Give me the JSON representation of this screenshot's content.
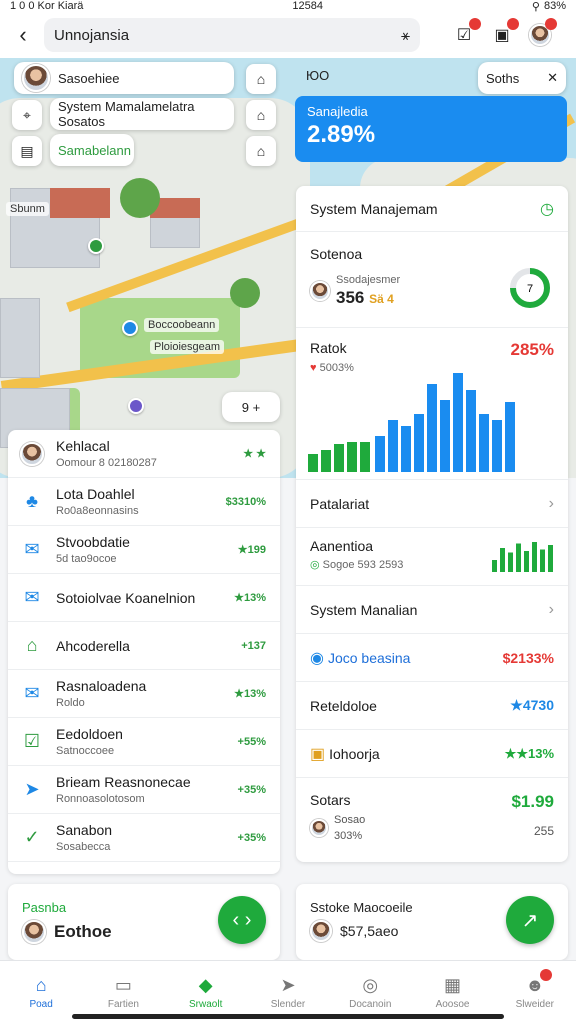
{
  "status": {
    "carrier": "1 0 0 Kor Kiarä",
    "time": "12584",
    "battery": "83%"
  },
  "topbar": {
    "title": "Unnojansia",
    "search_icon_glyph": "⚹"
  },
  "map": {
    "chips": [
      "Sasoehiee",
      "System Mamalamelatra Sosatos",
      "Samabelann"
    ],
    "labels": [
      "Sbunm",
      "Boccoobeann",
      "Ploioiesgeam"
    ],
    "zoom_label": "9  +",
    "top_text": "ЮO",
    "filter_label": "Soths"
  },
  "blue_card": {
    "title": "Sanajledia",
    "value": "2.89%"
  },
  "left_list": [
    {
      "name": "Kehlacal",
      "sub": "Oomour 8 02180287",
      "value": "★ ★",
      "icon": "avatar"
    },
    {
      "name": "Lota Doahlel",
      "sub": "Ro0a8eonnasins",
      "value": "$3310%",
      "icon": "tree-icon"
    },
    {
      "name": "Stvoobdatie",
      "sub": "5d tao9ocoe",
      "value": "★199",
      "icon": "mail-icon"
    },
    {
      "name": "Sotoiolvae Koanelnion",
      "sub": "",
      "value": "★13%",
      "icon": "send-mail-icon"
    },
    {
      "name": "Ahcoderella",
      "sub": "",
      "value": "+137",
      "icon": "home-icon"
    },
    {
      "name": "Rasnaloadena",
      "sub": "Roldo",
      "value": "★13%",
      "icon": "mail-icon"
    },
    {
      "name": "Eedoldoen",
      "sub": "Satnoccoee",
      "value": "+55%",
      "icon": "check-box-icon"
    },
    {
      "name": "Brieam Reasnonecae",
      "sub": "Ronnoasolotosom",
      "value": "+35%",
      "icon": "send-icon"
    },
    {
      "name": "Sanabon",
      "sub": "Sosabecca",
      "value": "+35%",
      "icon": "check-icon"
    }
  ],
  "left_card": {
    "title": "Pasnba",
    "name": "Eothoe",
    "action_glyph": "‹ ›"
  },
  "right_panel": {
    "header": "System Manajemam",
    "sotona": {
      "title": "Sotenoa",
      "sub": "Ssodajesmer",
      "value": "356",
      "value_suffix": "Sä 4",
      "ring_label": "7"
    },
    "chart": {
      "title": "Ratok",
      "sub": "5003%",
      "value": "285%"
    },
    "rows": [
      {
        "label": "Patalariat"
      },
      {
        "label": "Aanentioa",
        "sub": "Sogoe 593 2593"
      },
      {
        "label": "System Manalian"
      },
      {
        "label": "Joco beasina",
        "value": "$2133%"
      },
      {
        "label": "Reteldoloe",
        "value": "★4730"
      },
      {
        "label": "Iohoorja",
        "value": "★★13%"
      },
      {
        "label": "Sotars",
        "sub": "Sosao",
        "sub2": "303%",
        "value": "$1.99",
        "value2": "255"
      }
    ]
  },
  "right_card": {
    "title": "Sstoke Maocoeile",
    "value": "$57,5aeo",
    "action_glyph": "↗"
  },
  "nav": [
    {
      "label": "Poad"
    },
    {
      "label": "Fartien"
    },
    {
      "label": "Srwaolt"
    },
    {
      "label": "Slender"
    },
    {
      "label": "Docanoin"
    },
    {
      "label": "Aoosoe"
    },
    {
      "label": "Slweider"
    }
  ],
  "chart_data": {
    "type": "bar",
    "title": "Ratok",
    "series": [
      {
        "values": [
          18,
          22,
          28,
          30,
          30
        ]
      },
      {
        "values": [
          36,
          52,
          46,
          58,
          88,
          72,
          99,
          82,
          58,
          52,
          70
        ]
      }
    ],
    "ylim": [
      0,
      100
    ]
  },
  "mini_bars": {
    "values": [
      40,
      80,
      65,
      95,
      70,
      100,
      75,
      90
    ]
  },
  "colors": {
    "accent": "#1a8cf0",
    "green": "#1faa3c",
    "red": "#e53935"
  }
}
